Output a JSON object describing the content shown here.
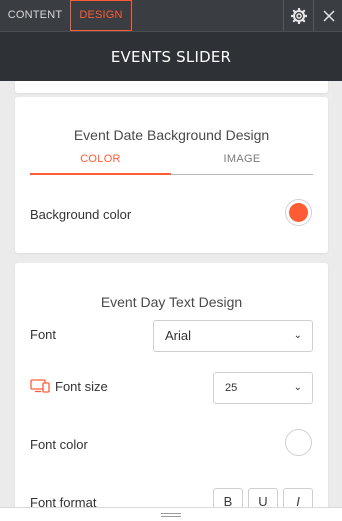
{
  "topbar": {
    "tabs": [
      {
        "label": "CONTENT"
      },
      {
        "label": "DESIGN"
      }
    ],
    "settings_icon": "gear-icon",
    "close_icon": "close-icon"
  },
  "header": {
    "title": "EVENTS SLIDER"
  },
  "date_bg_card": {
    "title": "Event Date Background Design",
    "tabs": [
      {
        "label": "COLOR"
      },
      {
        "label": "IMAGE"
      }
    ],
    "background_color_label": "Background color",
    "background_color_value": "#ff5c35"
  },
  "day_text_card": {
    "title": "Event Day Text Design",
    "font_label": "Font",
    "font_value": "Arial",
    "font_size_label": "Font size",
    "font_size_icon": "desktop-mobile-icon",
    "font_size_value": "25",
    "font_color_label": "Font color",
    "font_color_value": "#ffffff",
    "font_format_label": "Font format",
    "format_buttons": [
      {
        "label": "B"
      },
      {
        "label": "U"
      },
      {
        "label": "I"
      }
    ]
  },
  "colors": {
    "accent": "#ff5c35",
    "topbar": "#3a3d42",
    "header": "#2e3135",
    "panel_bg": "#ebebeb"
  }
}
